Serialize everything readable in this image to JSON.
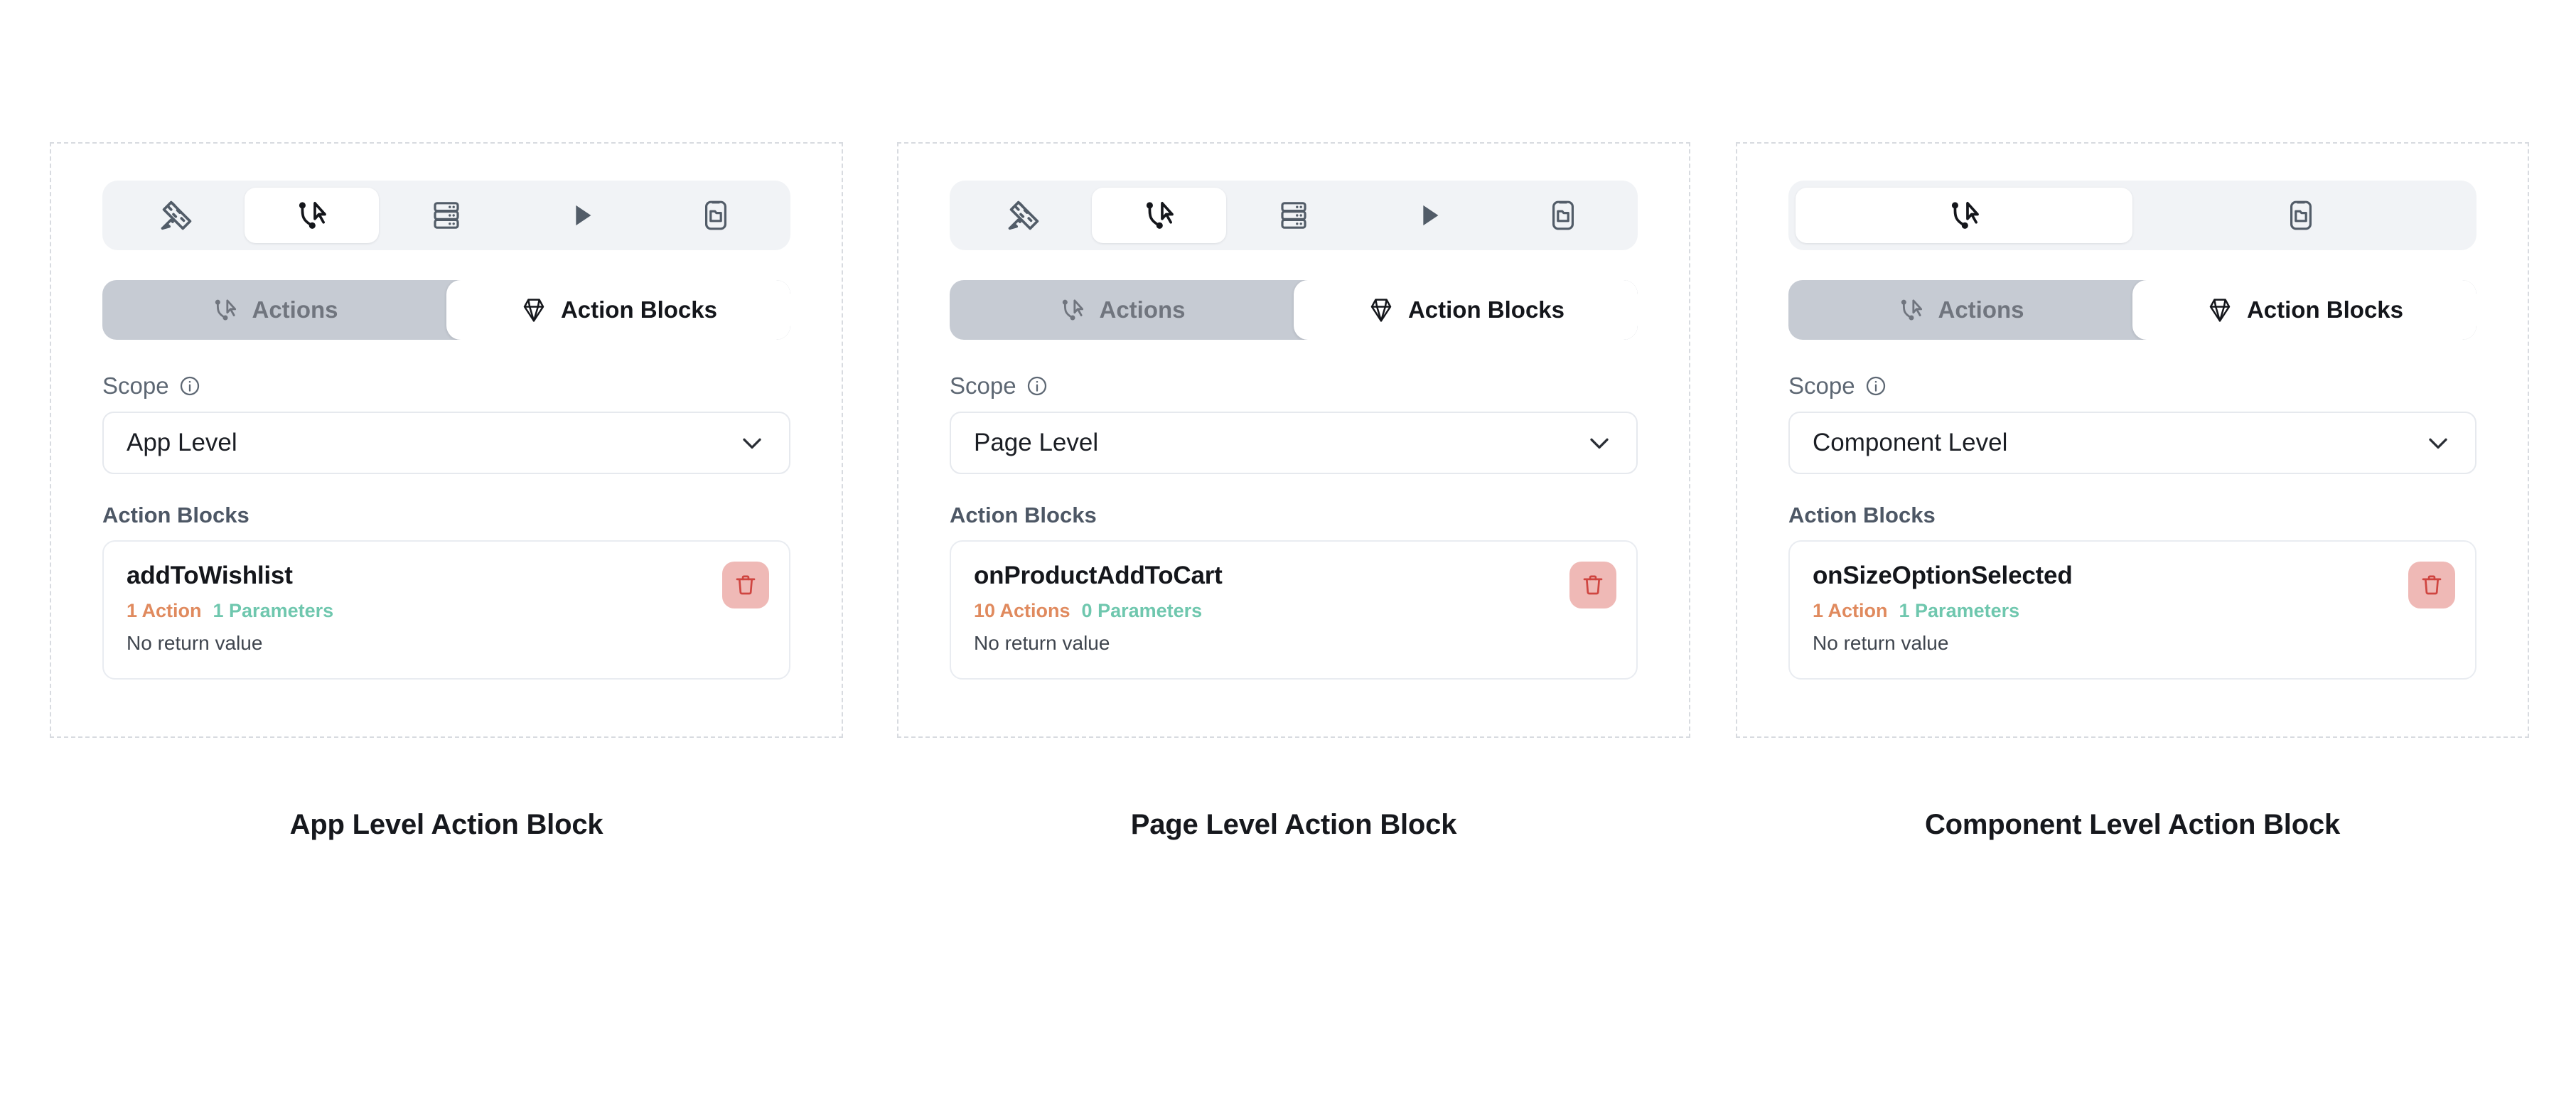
{
  "columns": [
    {
      "caption": "App Level Action Block",
      "toolbar": {
        "items": [
          {
            "icon": "ruler-pencil-icon",
            "name": "design-tool",
            "active": false
          },
          {
            "icon": "cursor-flow-icon",
            "name": "actions-tool",
            "active": true
          },
          {
            "icon": "server-stack-icon",
            "name": "data-tool",
            "active": false
          },
          {
            "icon": "play-icon",
            "name": "preview-tool",
            "active": false
          },
          {
            "icon": "phone-folder-icon",
            "name": "app-tool",
            "active": false
          }
        ]
      },
      "tabs": [
        {
          "label": "Actions",
          "icon": "cursor-flow-icon",
          "active": false
        },
        {
          "label": "Action Blocks",
          "icon": "diamond-icon",
          "active": true
        }
      ],
      "scope": {
        "label": "Scope",
        "info_icon": "info-circle-icon",
        "value": "App Level",
        "chevron_icon": "chevron-down-icon"
      },
      "section_title": "Action Blocks",
      "block": {
        "name": "addToWishlist",
        "actions": "1 Action",
        "parameters": "1 Parameters",
        "return_value": "No return value",
        "delete_icon": "trash-icon"
      }
    },
    {
      "caption": "Page Level Action Block",
      "toolbar": {
        "items": [
          {
            "icon": "ruler-pencil-icon",
            "name": "design-tool",
            "active": false
          },
          {
            "icon": "cursor-flow-icon",
            "name": "actions-tool",
            "active": true
          },
          {
            "icon": "server-stack-icon",
            "name": "data-tool",
            "active": false
          },
          {
            "icon": "play-icon",
            "name": "preview-tool",
            "active": false
          },
          {
            "icon": "phone-folder-icon",
            "name": "app-tool",
            "active": false
          }
        ]
      },
      "tabs": [
        {
          "label": "Actions",
          "icon": "cursor-flow-icon",
          "active": false
        },
        {
          "label": "Action Blocks",
          "icon": "diamond-icon",
          "active": true
        }
      ],
      "scope": {
        "label": "Scope",
        "info_icon": "info-circle-icon",
        "value": "Page Level",
        "chevron_icon": "chevron-down-icon"
      },
      "section_title": "Action Blocks",
      "block": {
        "name": "onProductAddToCart",
        "actions": "10 Actions",
        "parameters": "0 Parameters",
        "return_value": "No return value",
        "delete_icon": "trash-icon"
      }
    },
    {
      "caption": "Component Level Action Block",
      "toolbar": {
        "items": [
          {
            "icon": "cursor-flow-icon",
            "name": "actions-tool",
            "active": true
          },
          {
            "icon": "phone-folder-icon",
            "name": "app-tool",
            "active": false
          }
        ]
      },
      "tabs": [
        {
          "label": "Actions",
          "icon": "cursor-flow-icon",
          "active": false
        },
        {
          "label": "Action Blocks",
          "icon": "diamond-icon",
          "active": true
        }
      ],
      "scope": {
        "label": "Scope",
        "info_icon": "info-circle-icon",
        "value": "Component Level",
        "chevron_icon": "chevron-down-icon"
      },
      "section_title": "Action Blocks",
      "block": {
        "name": "onSizeOptionSelected",
        "actions": "1 Action",
        "parameters": "1 Parameters",
        "return_value": "No return value",
        "delete_icon": "trash-icon"
      }
    }
  ],
  "colors": {
    "accent_orange": "#e08a5e",
    "accent_teal": "#6fc7ae",
    "delete_bg": "#efb9b6",
    "delete_fg": "#cf4540",
    "toolbar_bg": "#f1f3f6",
    "segmented_bg": "#c6cbd3",
    "card_border": "#d8dbe0",
    "icon_gray": "#525c68"
  }
}
